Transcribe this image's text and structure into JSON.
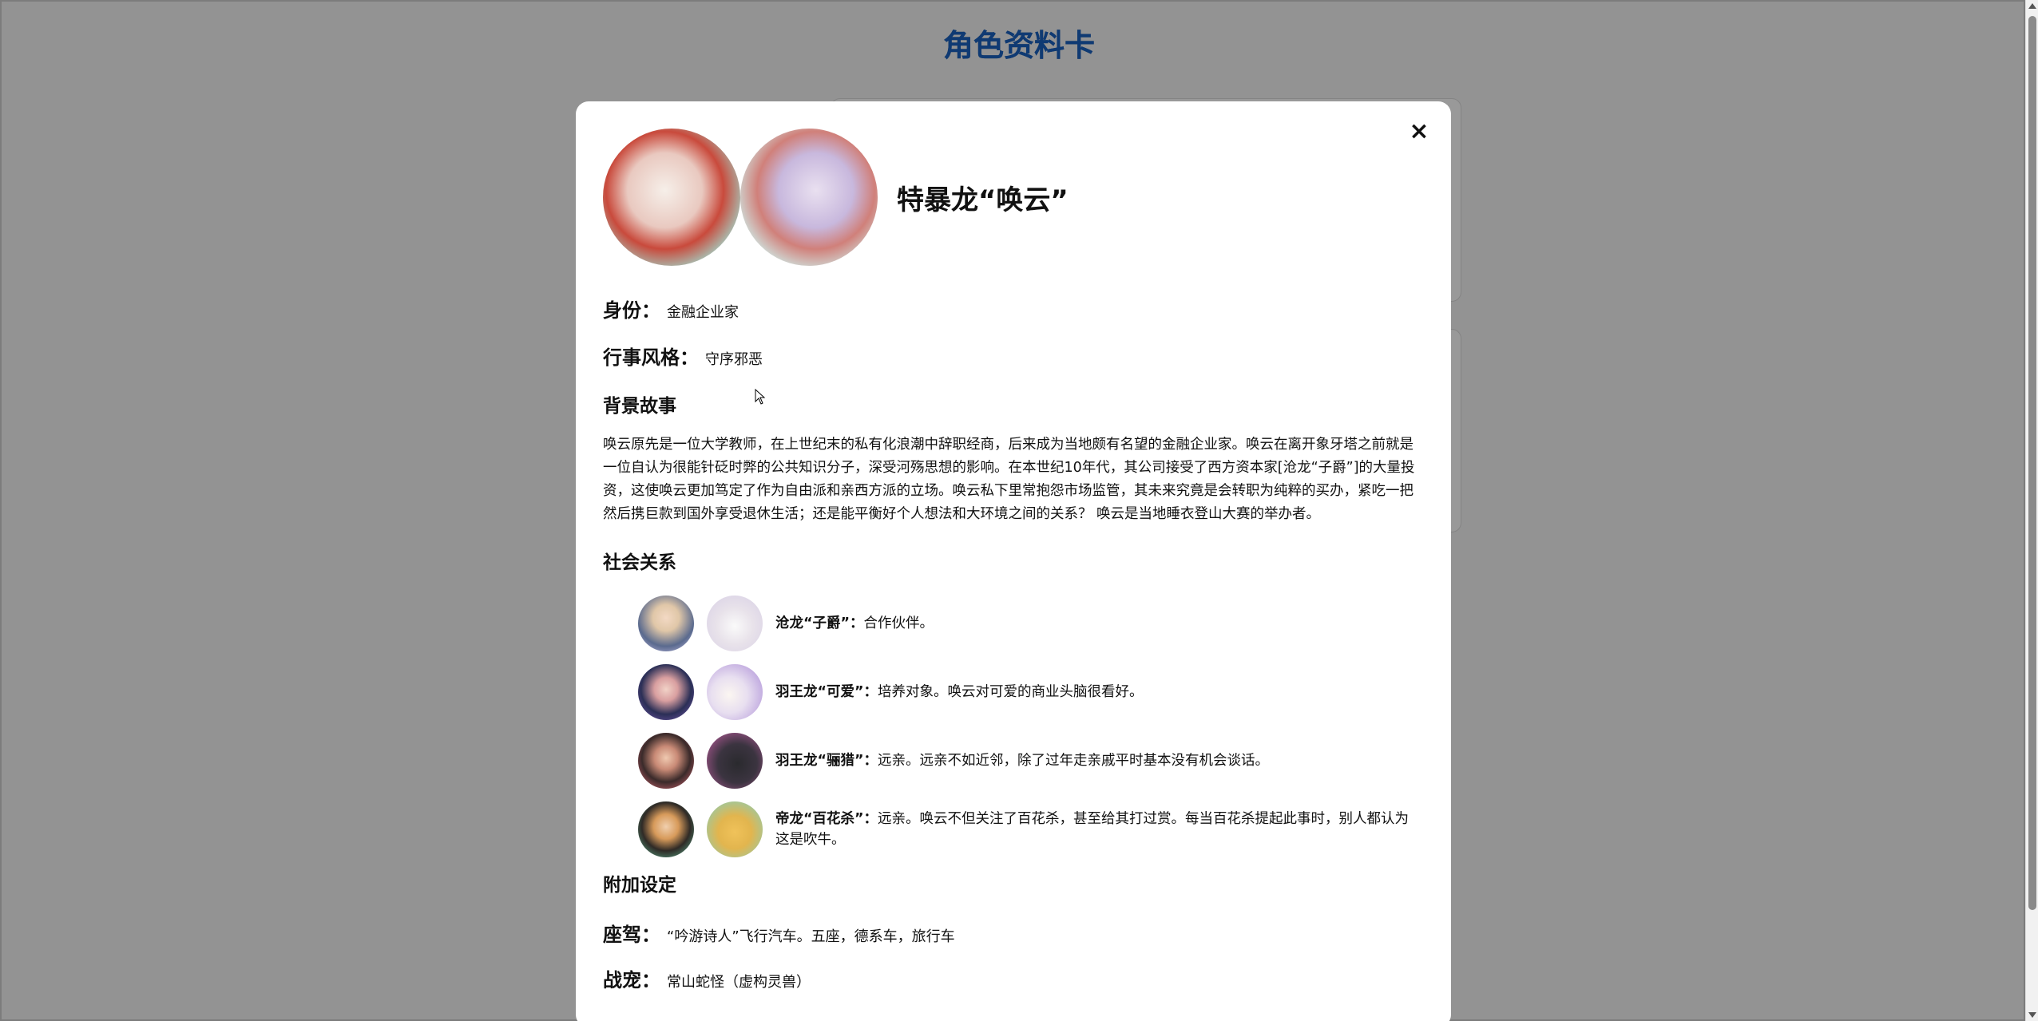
{
  "page": {
    "title": "角色资料卡"
  },
  "modal": {
    "close_symbol": "×",
    "name": "特暴龙“唤云”",
    "avatar_icons": [
      "portrait-icon",
      "dragon-icon"
    ],
    "identity": {
      "label": "身份：",
      "value": "金融企业家"
    },
    "style": {
      "label": "行事风格：",
      "value": "守序邪恶"
    },
    "background": {
      "title": "背景故事",
      "text": "唤云原先是一位大学教师，在上世纪末的私有化浪潮中辞职经商，后来成为当地颇有名望的金融企业家。唤云在离开象牙塔之前就是一位自认为很能针砭时弊的公共知识分子，深受河殇思想的影响。在本世纪10年代，其公司接受了西方资本家[沧龙“子爵”]的大量投资，这使唤云更加笃定了作为自由派和亲西方派的立场。唤云私下里常抱怨市场监管，其未来究竟是会转职为纯粹的买办，紧吃一把然后携巨款到国外享受退休生活；还是能平衡好个人想法和大环境之间的关系？ 唤云是当地睡衣登山大赛的举办者。"
    },
    "relations": {
      "title": "社会关系",
      "items": [
        {
          "name": "沧龙“子爵”：",
          "desc": "合作伙伴。",
          "colors": [
            "#c9c2ea",
            "#e4dbe8"
          ]
        },
        {
          "name": "羽王龙“可爱”：",
          "desc": "培养对象。唤云对可爱的商业头脑很看好。",
          "colors": [
            "#7b5bb5",
            "#a98ad6"
          ]
        },
        {
          "name": "羽王龙“骊猎”：",
          "desc": "远亲。远亲不如近邻，除了过年走亲戚平时基本没有机会谈话。",
          "colors": [
            "#e86d7a",
            "#c35fa3"
          ]
        },
        {
          "name": "帝龙“百花杀”：",
          "desc": "远亲。唤云不但关注了百花杀，甚至给其打过赏。每当百花杀提起此事时，别人都认为这是吹牛。",
          "colors": [
            "#5fbf9a",
            "#7ed1c4"
          ]
        }
      ]
    },
    "extra": {
      "title": "附加设定",
      "vehicle": {
        "label": "座驾：",
        "value": "“吟游诗人”飞行汽车。五座，德系车，旅行车"
      },
      "pet": {
        "label": "战宠：",
        "value": "常山蛇怪（虚构灵兽）"
      }
    }
  }
}
